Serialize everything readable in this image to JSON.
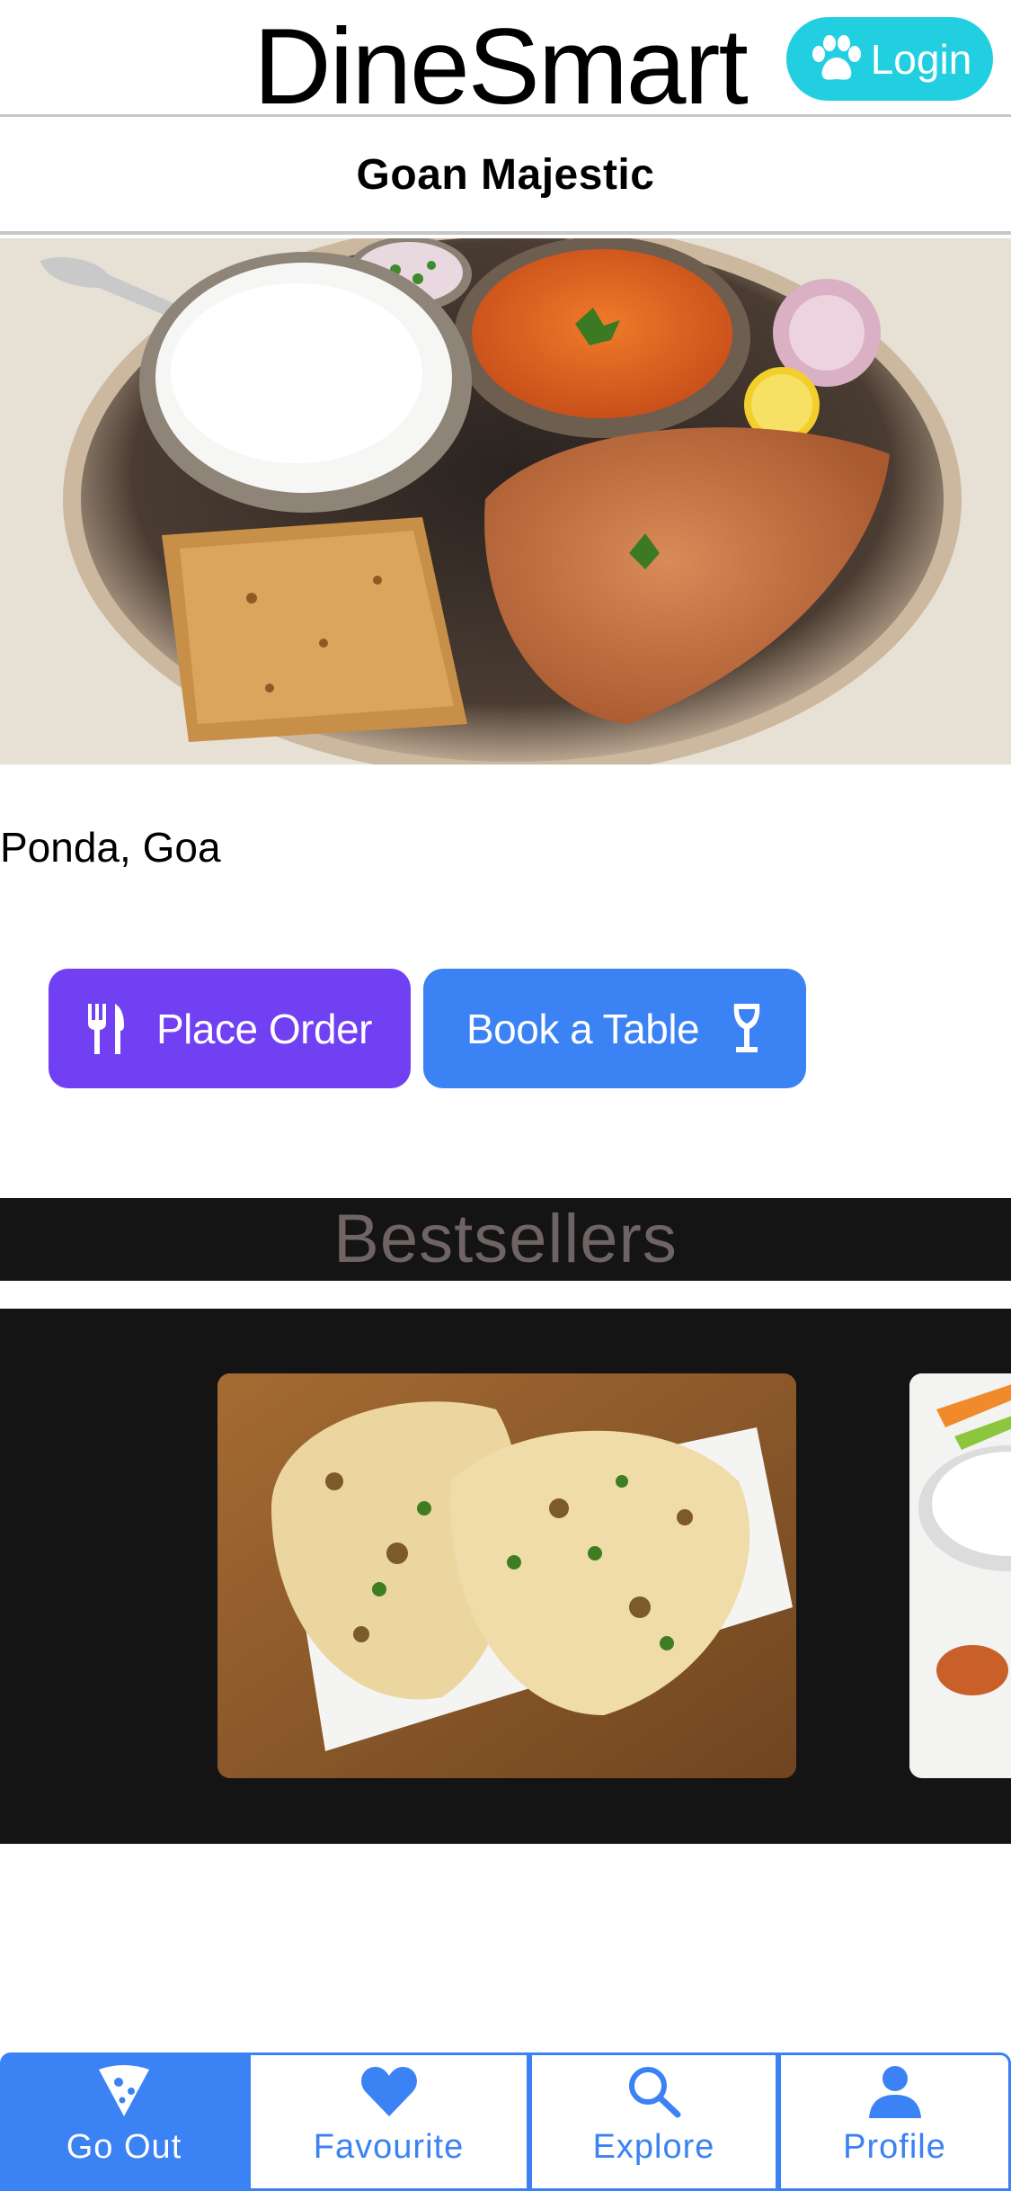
{
  "header": {
    "app_title": "DineSmart",
    "login_label": "Login"
  },
  "restaurant": {
    "name": "Goan Majestic",
    "location": "Ponda, Goa"
  },
  "actions": {
    "place_order_label": "Place Order",
    "book_table_label": "Book a Table"
  },
  "bestsellers": {
    "title": "Bestsellers"
  },
  "tabs": [
    {
      "label": "Go Out",
      "icon": "pizza-slice-icon",
      "active": true
    },
    {
      "label": "Favourite",
      "icon": "heart-icon",
      "active": false
    },
    {
      "label": "Explore",
      "icon": "search-icon",
      "active": false
    },
    {
      "label": "Profile",
      "icon": "user-icon",
      "active": false
    }
  ],
  "colors": {
    "login": "#22cfe0",
    "place_order": "#7140f2",
    "book_table": "#3b82f4",
    "section_bg": "#141414",
    "section_title": "#6f6363",
    "tab_accent": "#3b82f4"
  }
}
